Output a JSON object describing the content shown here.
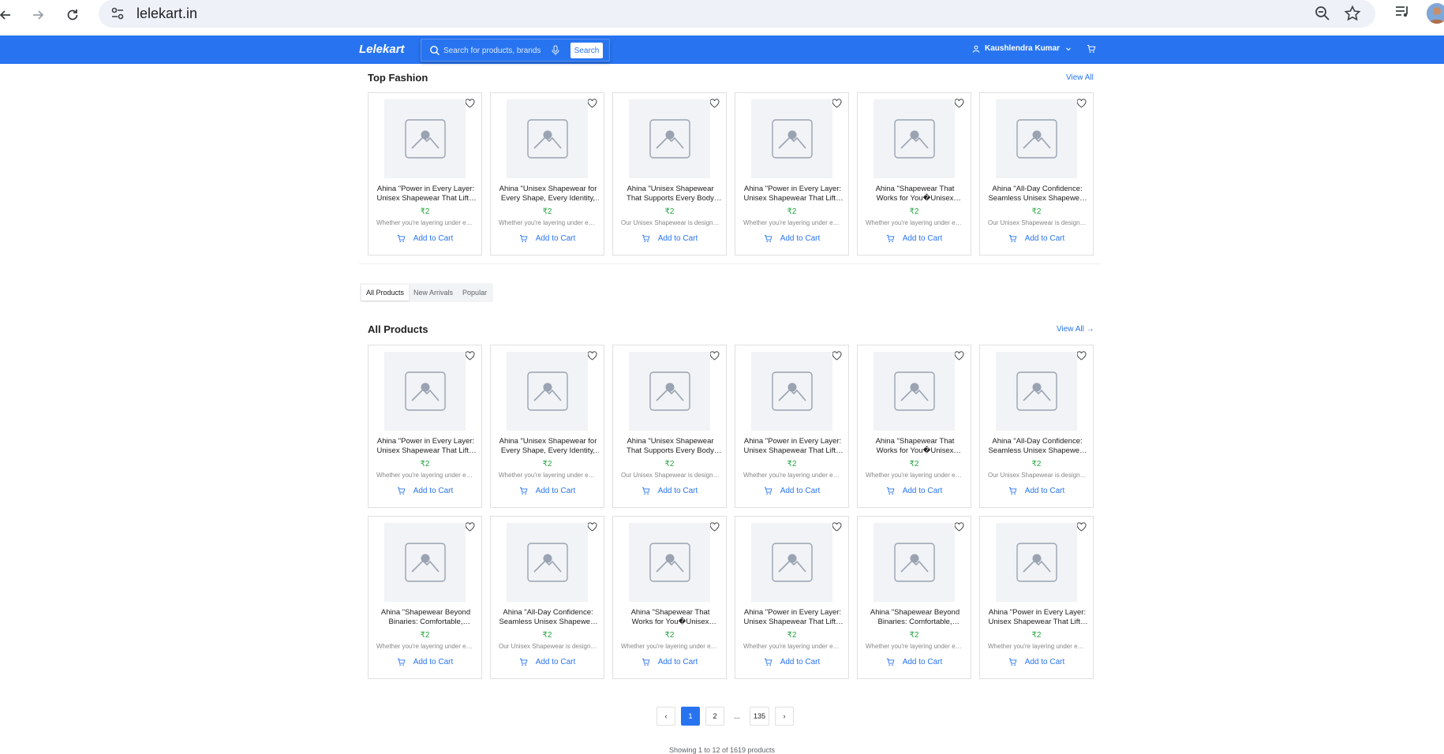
{
  "browser": {
    "url": "lelekart.in"
  },
  "header": {
    "logo": "Lelekart",
    "search_placeholder": "Search for products, brands",
    "search_button": "Search",
    "user_name": "Kaushlendra Kumar",
    "brand_color": "#2874f0"
  },
  "top_fashion": {
    "title": "Top Fashion",
    "view_all": "View All",
    "products": [
      {
        "name": "Ahina \"Power in Every Layer: Unisex Shapewear That Lifts, Smooths",
        "price": "₹2",
        "desc": "Whether you're layering under everything",
        "cta": "Add to Cart"
      },
      {
        "name": "Ahina \"Unisex Shapewear for Every Shape, Every Identity, and",
        "price": "₹2",
        "desc": "Whether you're layering under everything",
        "cta": "Add to Cart"
      },
      {
        "name": "Ahina \"Unisex Shapewear That Supports Every Body Type and",
        "price": "₹2",
        "desc": "Our Unisex Shapewear is designed",
        "cta": "Add to Cart"
      },
      {
        "name": "Ahina \"Power in Every Layer: Unisex Shapewear That Lifts, Smooths",
        "price": "₹2",
        "desc": "Whether you're layering under everything",
        "cta": "Add to Cart"
      },
      {
        "name": "Ahina \"Shapewear That Works for You�Unisex Design, Universal",
        "price": "₹2",
        "desc": "Whether you're layering under everything",
        "cta": "Add to Cart"
      },
      {
        "name": "Ahina \"All-Day Confidence: Seamless Unisex Shapewear for",
        "price": "₹2",
        "desc": "Our Unisex Shapewear is designed",
        "cta": "Add to Cart"
      }
    ]
  },
  "tabs": [
    {
      "label": "All Products",
      "active": true
    },
    {
      "label": "New Arrivals",
      "active": false
    },
    {
      "label": "Popular",
      "active": false
    }
  ],
  "all_products": {
    "title": "All Products",
    "view_all": "View All →",
    "products": [
      {
        "name": "Ahina \"Power in Every Layer: Unisex Shapewear That Lifts, Smooths",
        "price": "₹2",
        "desc": "Whether you're layering under everything",
        "cta": "Add to Cart"
      },
      {
        "name": "Ahina \"Unisex Shapewear for Every Shape, Every Identity, and",
        "price": "₹2",
        "desc": "Whether you're layering under everything",
        "cta": "Add to Cart"
      },
      {
        "name": "Ahina \"Unisex Shapewear That Supports Every Body Type and",
        "price": "₹2",
        "desc": "Our Unisex Shapewear is designed",
        "cta": "Add to Cart"
      },
      {
        "name": "Ahina \"Power in Every Layer: Unisex Shapewear That Lifts, Smooths",
        "price": "₹2",
        "desc": "Whether you're layering under everything",
        "cta": "Add to Cart"
      },
      {
        "name": "Ahina \"Shapewear That Works for You�Unisex Design, Universal",
        "price": "₹2",
        "desc": "Whether you're layering under everything",
        "cta": "Add to Cart"
      },
      {
        "name": "Ahina \"All-Day Confidence: Seamless Unisex Shapewear for",
        "price": "₹2",
        "desc": "Our Unisex Shapewear is designed",
        "cta": "Add to Cart"
      },
      {
        "name": "Ahina \"Shapewear Beyond Binaries: Comfortable, Confident",
        "price": "₹2",
        "desc": "Whether you're layering under everything",
        "cta": "Add to Cart"
      },
      {
        "name": "Ahina \"All-Day Confidence: Seamless Unisex Shapewear for",
        "price": "₹2",
        "desc": "Our Unisex Shapewear is designed",
        "cta": "Add to Cart"
      },
      {
        "name": "Ahina \"Shapewear That Works for You�Unisex Design, Universal",
        "price": "₹2",
        "desc": "Whether you're layering under everything",
        "cta": "Add to Cart"
      },
      {
        "name": "Ahina \"Power in Every Layer: Unisex Shapewear That Lifts, Smooths",
        "price": "₹2",
        "desc": "Whether you're layering under everything",
        "cta": "Add to Cart"
      },
      {
        "name": "Ahina \"Shapewear Beyond Binaries: Comfortable, Confident",
        "price": "₹2",
        "desc": "Whether you're layering under everything",
        "cta": "Add to Cart"
      },
      {
        "name": "Ahina \"Power in Every Layer: Unisex Shapewear That Lifts, Smooths",
        "price": "₹2",
        "desc": "Whether you're layering under everything",
        "cta": "Add to Cart"
      }
    ]
  },
  "pagination": {
    "prev": "‹",
    "pages": [
      "1",
      "2",
      "...",
      "135"
    ],
    "current": "1",
    "next": "›",
    "summary": "Showing 1 to 12 of 1619 products"
  }
}
